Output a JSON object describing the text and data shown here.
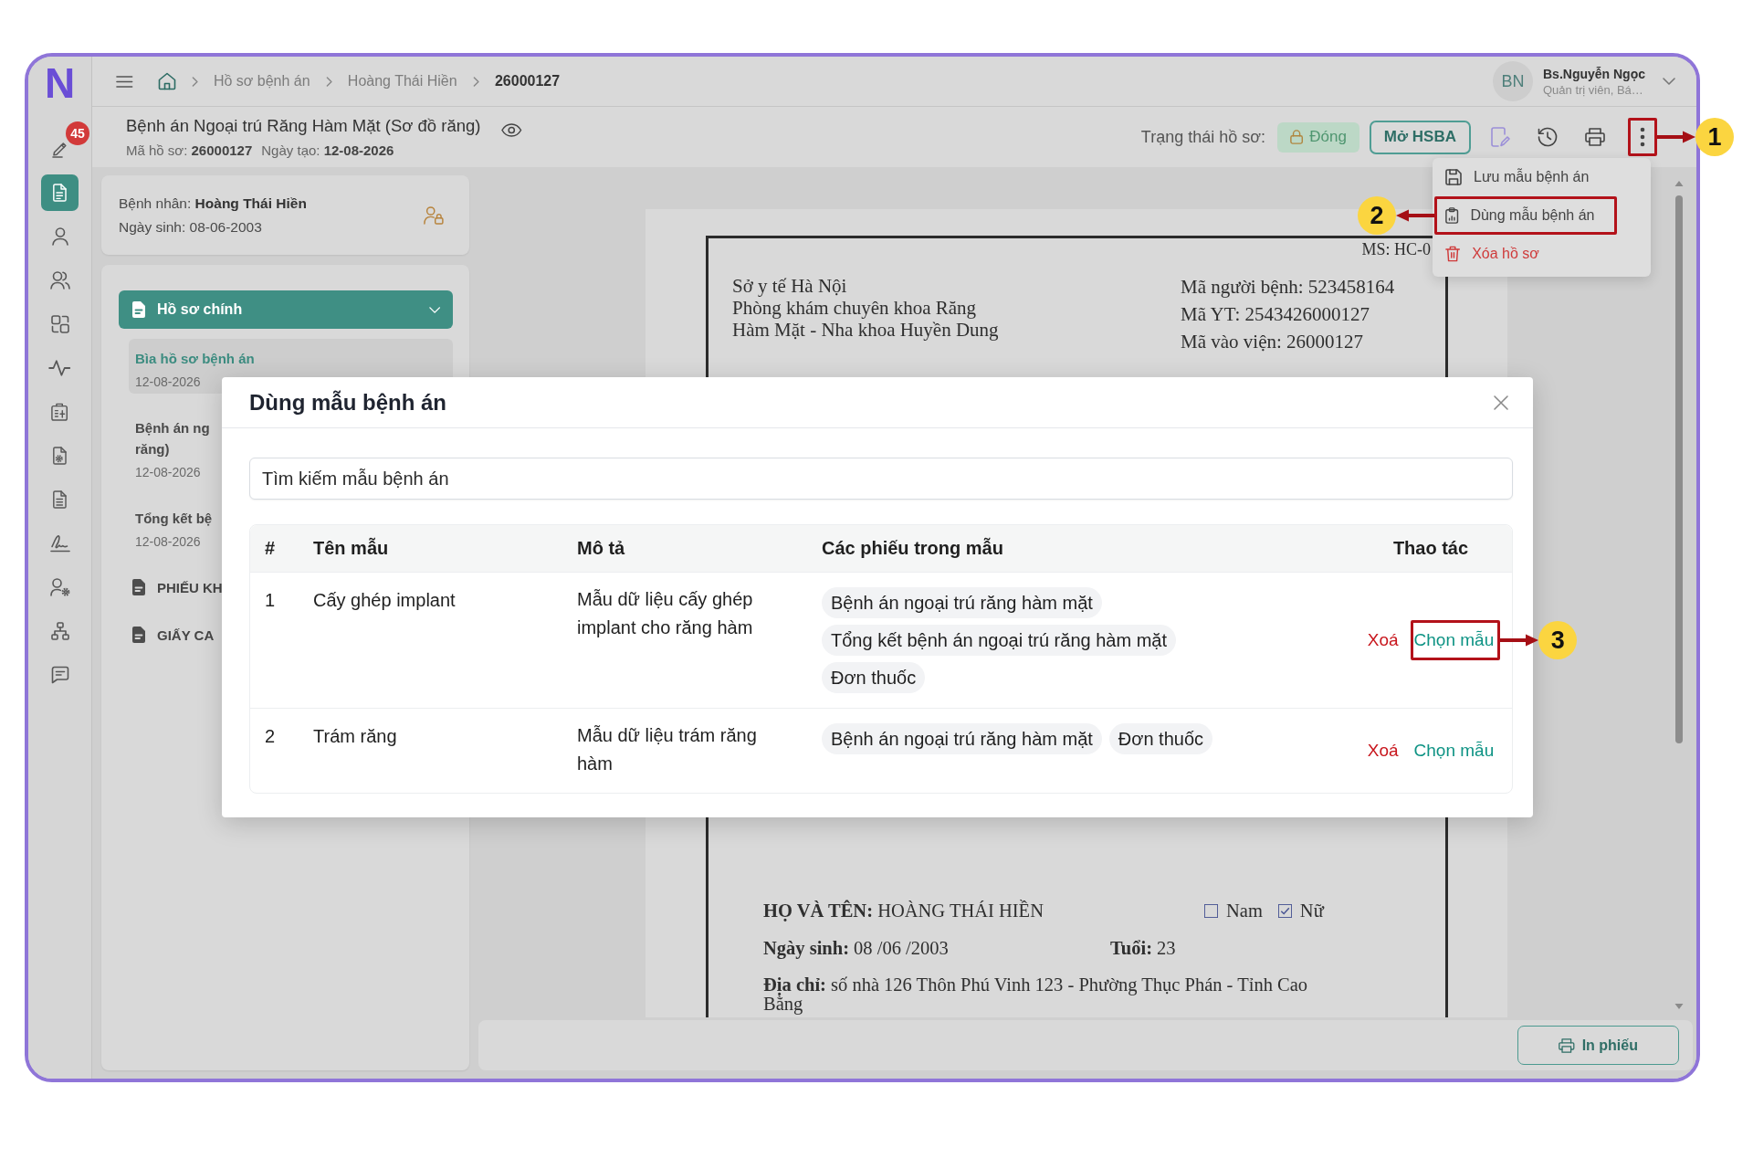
{
  "app": {
    "logo": "N"
  },
  "rail": {
    "items": [
      {
        "selected": false,
        "badge": "45"
      },
      {
        "selected": true
      },
      {
        "selected": false
      },
      {
        "selected": false
      },
      {
        "selected": false
      },
      {
        "selected": false
      },
      {
        "selected": false
      },
      {
        "selected": false
      },
      {
        "selected": false
      },
      {
        "selected": false
      },
      {
        "selected": false
      },
      {
        "selected": false
      },
      {
        "selected": false
      }
    ]
  },
  "topbar": {
    "breadcrumbs": [
      "Hồ sơ bệnh án",
      "Hoàng Thái Hiền",
      "26000127"
    ],
    "user": {
      "initials": "BN",
      "name": "Bs.Nguyễn Ngọc",
      "role": "Quản trị viên, Bá…"
    }
  },
  "record": {
    "title": "Bệnh án Ngoại trú Răng Hàm Mặt (Sơ đồ răng)",
    "meta": [
      "Mã hồ sơ: **26000127**",
      "Ngày tạo: **12-08-2026**"
    ],
    "status_label": "Trạng thái hồ sơ:",
    "status": "Đóng"
  },
  "toolbar": {
    "open_button": "Mở HSBA",
    "more": {
      "expanded": true,
      "callout": "1"
    }
  },
  "menu": {
    "items": [
      {
        "label": "Lưu mẫu bệnh án",
        "danger": false
      },
      {
        "label": "Dùng mẫu bệnh án",
        "danger": false,
        "callout": "2"
      },
      {
        "label": "Xóa hồ sơ",
        "danger": true
      }
    ]
  },
  "patient": {
    "lines": [
      "Bệnh nhân: **Hoàng Thái Hiền**",
      "Ngày sinh: 08-06-2003"
    ]
  },
  "records_tree": {
    "groups": [
      {
        "label": "Hồ sơ chính",
        "expanded": true,
        "children": [
          {
            "title": "Bìa hồ sơ bệnh án",
            "date": "12-08-2026",
            "selected": true
          },
          {
            "title": "Bệnh án ng\nrăng)",
            "date": "12-08-2026",
            "selected": false
          },
          {
            "title": "Tổng kết bệ",
            "date": "12-08-2026",
            "selected": false
          }
        ]
      },
      {
        "label": "PHIẾU KH",
        "expanded": false
      },
      {
        "label": "GIẤY CA",
        "expanded": false
      }
    ]
  },
  "document": {
    "form_code": "MS: HC-0",
    "organization": [
      "Sở y tế Hà Nội",
      "Phòng khám chuyên khoa Răng Hàm Mặt - Nha khoa Huyền Dung"
    ],
    "codes": [
      "Mã người bệnh: 523458164",
      "Mã YT: 2543426000127",
      "Mã vào viện: 26000127"
    ],
    "full_name": "**HỌ VÀ TÊN:** HOÀNG THÁI HIỀN",
    "sex": [
      {
        "label": "Nam",
        "checked": false
      },
      {
        "label": "Nữ",
        "checked": true
      }
    ],
    "birth_date": "**Ngày sinh:** 08 /06 /2003",
    "age": "**Tuổi:** 23",
    "address": "**Địa chỉ:** số nhà 126 Thôn Phú Vinh 123 - Phường Thục Phán - Tỉnh Cao Bằng"
  },
  "footer": {
    "print_button": "In phiếu"
  },
  "dialog": {
    "title": "Dùng mẫu bệnh án",
    "search": {
      "placeholder": "Tìm kiếm mẫu bệnh án"
    },
    "table": {
      "columns": [
        "#",
        "Tên mẫu",
        "Mô tả",
        "Các phiếu trong mẫu",
        "Thao tác"
      ],
      "rows": [
        {
          "index": "1",
          "name": "Cấy ghép implant",
          "description": "Mẫu dữ liệu cấy ghép implant cho răng hàm",
          "forms": [
            "Bệnh án ngoại trú răng hàm mặt",
            "Tổng kết bệnh án ngoại trú răng hàm mặt",
            "Đơn thuốc"
          ],
          "actions": [
            {
              "kind": "delete",
              "label": "Xoá"
            },
            {
              "kind": "select",
              "label": "Chọn mẫu",
              "callout": "3"
            }
          ]
        },
        {
          "index": "2",
          "name": "Trám răng",
          "description": "Mẫu dữ liệu trám răng hàm",
          "forms": [
            "Bệnh án ngoại trú răng hàm mặt",
            "Đơn thuốc"
          ],
          "actions": [
            {
              "kind": "delete",
              "label": "Xoá"
            },
            {
              "kind": "select",
              "label": "Chọn mẫu"
            }
          ]
        }
      ]
    }
  }
}
